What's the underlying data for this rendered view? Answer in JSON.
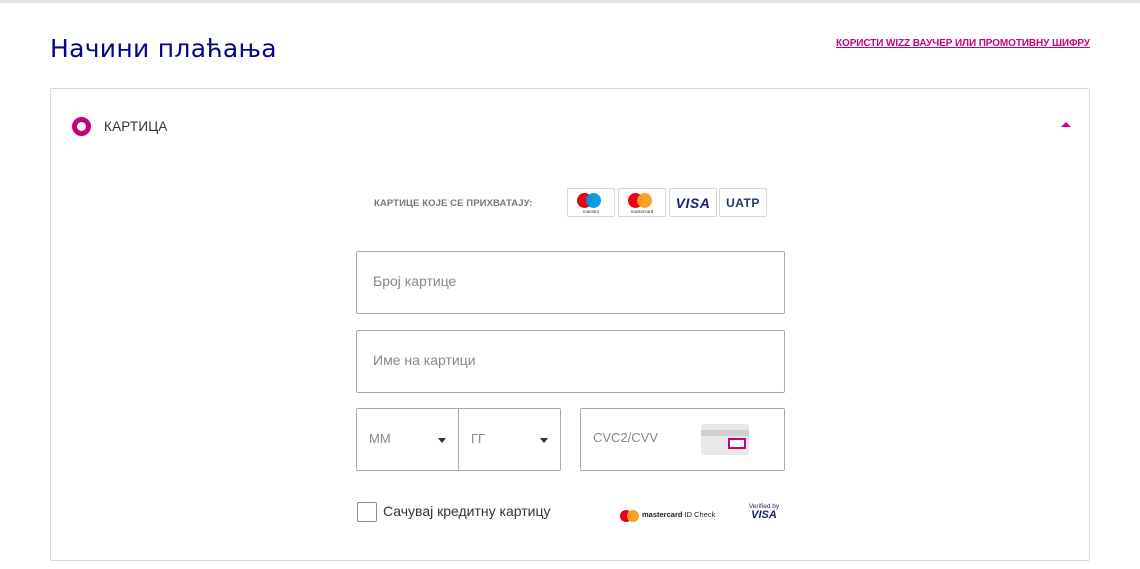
{
  "header": {
    "title": "Начини плаћања",
    "voucher_link": "КОРИСТИ WIZZ ВАУЧЕР ИЛИ ПРОМОТИВНУ ШИФРУ"
  },
  "payment_method": {
    "label": "КАРТИЦА",
    "selected": true,
    "expanded": true
  },
  "accepted_cards": {
    "label": "КАРТИЦЕ КОЈЕ СЕ ПРИХВАТАЈУ:",
    "logos": [
      {
        "name": "maestro",
        "caption": "maestro"
      },
      {
        "name": "mastercard",
        "caption": "mastercard"
      },
      {
        "name": "visa",
        "caption": "VISA"
      },
      {
        "name": "uatp",
        "caption": "UATP"
      }
    ]
  },
  "form": {
    "card_number_placeholder": "Број картице",
    "card_name_placeholder": "Име на картици",
    "month_placeholder": "ММ",
    "year_placeholder": "ГГ",
    "cvc_placeholder": "CVC2/CVV",
    "save_card_label": "Сачувај кредитну картицу",
    "save_card_checked": false
  },
  "secure": {
    "mastercard_brand": "mastercard",
    "mastercard_suffix": " ID Check",
    "verified_by": "Verified by",
    "visa": "VISA"
  },
  "colors": {
    "brand_magenta": "#c6007e",
    "title_navy": "#06038d",
    "visa_blue": "#1a1f71",
    "maestro_blue": "#0099df",
    "mc_red": "#eb001b",
    "mc_orange": "#f79e1b"
  }
}
